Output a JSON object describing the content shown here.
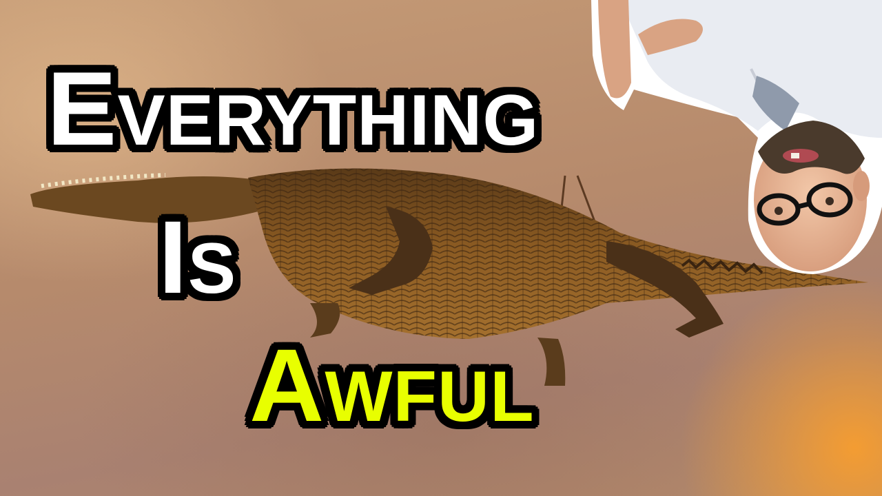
{
  "thumbnail": {
    "title_lines": [
      {
        "initial": "E",
        "rest": "VERYTHING",
        "color": "#ffffff"
      },
      {
        "initial": "I",
        "rest": "S",
        "color": "#ffffff"
      },
      {
        "initial": "A",
        "rest": "WFUL",
        "color": "#e8ff00"
      }
    ],
    "outline_color": "#000000"
  },
  "icons": {
    "crocodile": "hanging-crocodile-illustration",
    "person": "upside-down-man-cutout"
  }
}
